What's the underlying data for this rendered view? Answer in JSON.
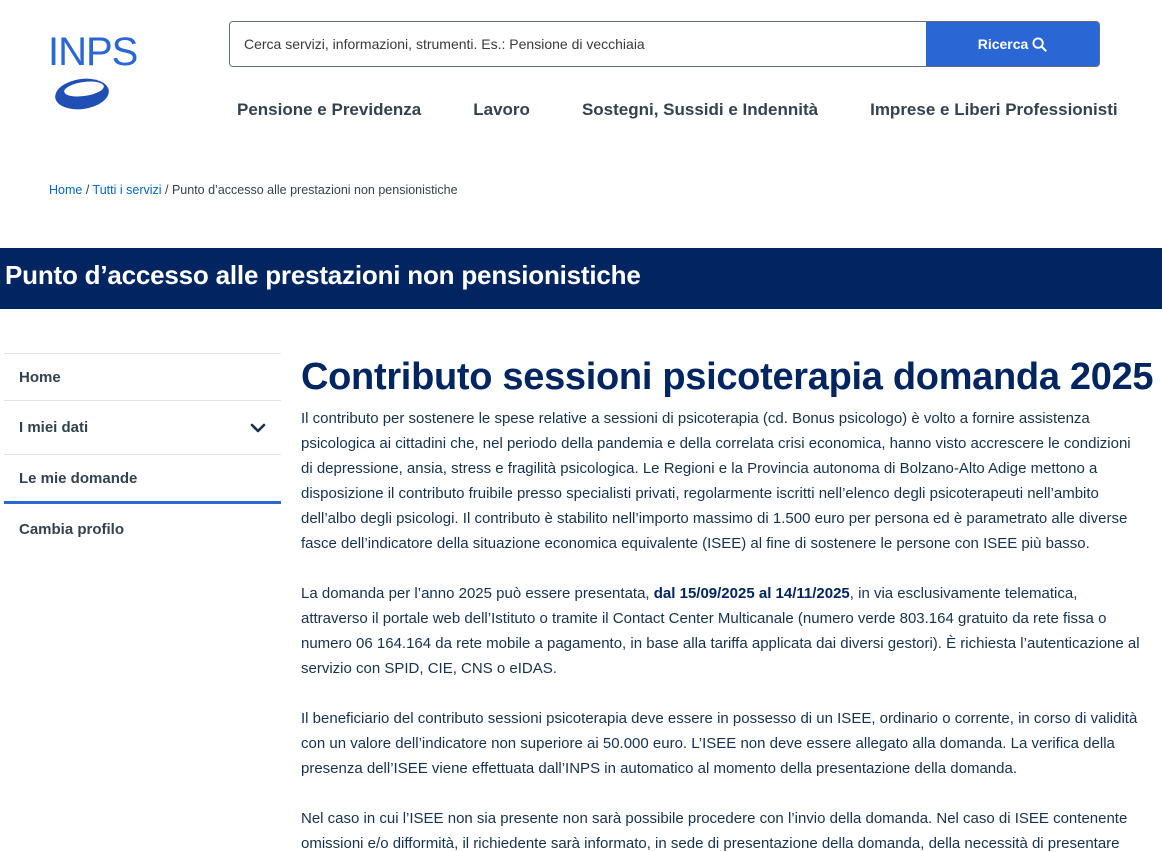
{
  "header": {
    "logo_text": "INPS",
    "search": {
      "placeholder": "Cerca servizi, informazioni, strumenti. Es.: Pensione di vecchiaia",
      "button_label": "Ricerca"
    },
    "nav": [
      "Pensione e Previdenza",
      "Lavoro",
      "Sostegni, Sussidi e Indennità",
      "Imprese e Liberi Professionisti"
    ]
  },
  "breadcrumb": {
    "home": "Home",
    "all_services": "Tutti i servizi",
    "current": "Punto d’accesso alle prestazioni non pensionistiche"
  },
  "band_title": "Punto d’accesso alle prestazioni non pensionistiche",
  "sidebar": {
    "items": [
      "Home",
      "I miei dati",
      "Le mie domande",
      "Cambia profilo"
    ]
  },
  "main": {
    "title": "Contributo sessioni psicoterapia domanda 2025",
    "p1": "Il contributo per sostenere le spese relative a sessioni di psicoterapia (cd. Bonus psicologo) è volto a fornire assistenza psicologica ai cittadini che, nel periodo della pandemia e della correlata crisi economica, hanno visto accrescere le condizioni di depressione, ansia, stress e fragilità psicologica. Le Regioni e la Provincia autonoma di Bolzano-Alto Adige mettono a disposizione il contributo fruibile presso specialisti privati, regolarmente iscritti nell’elenco degli psicoterapeuti nell’ambito dell’albo degli psicologi. Il contributo è stabilito nell’importo massimo di 1.500 euro per persona ed è parametrato alle diverse fasce dell’indicatore della situazione economica equivalente (ISEE) al fine di sostenere le persone con ISEE più basso.",
    "p2_pre": "La domanda per l’anno 2025 può essere presentata, ",
    "p2_bold": "dal 15/09/2025 al 14/11/2025",
    "p2_post": ", in via esclusivamente telematica, attraverso il portale web dell’Istituto o tramite il Contact Center Multicanale (numero verde 803.164 gratuito da rete fissa o numero 06 164.164 da rete mobile a pagamento, in base alla tariffa applicata dai diversi gestori). È richiesta l’autenticazione al servizio con SPID, CIE, CNS o eIDAS.",
    "p3": "Il beneficiario del contributo sessioni psicoterapia deve essere in possesso di un ISEE, ordinario o corrente, in corso di validità con un valore dell’indicatore non superiore ai 50.000 euro. L’ISEE non deve essere allegato alla domanda. La verifica della presenza dell’ISEE viene effettuata dall’INPS in automatico al momento della presentazione della domanda.",
    "p4": "Nel caso in cui l’ISEE non sia presente non sarà possibile procedere con l’invio della domanda. Nel caso di ISEE contenente omissioni e/o difformità, il richiedente sarà informato, in sede di presentazione della domanda, della necessità di presentare"
  }
}
